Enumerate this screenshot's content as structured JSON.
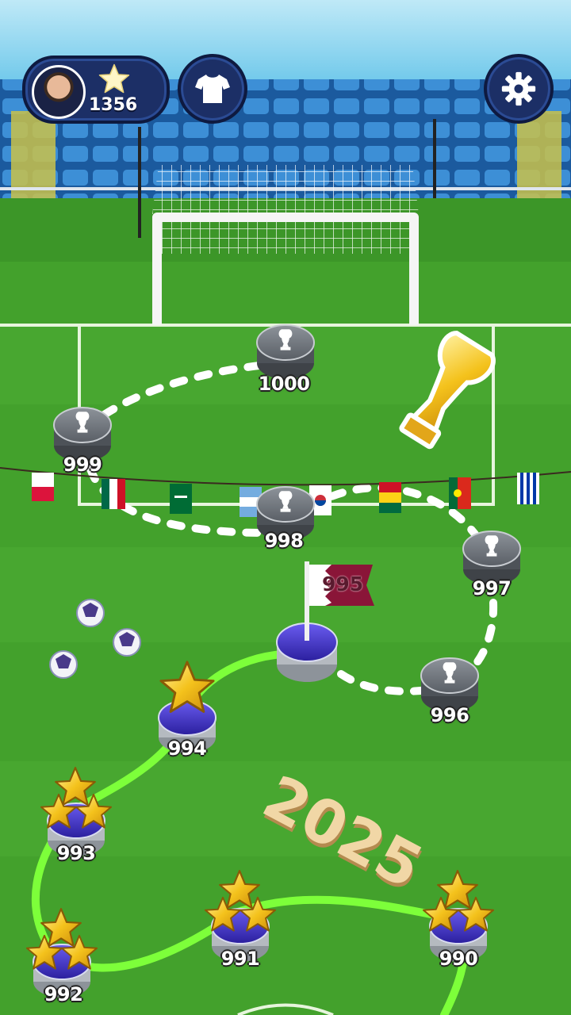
{
  "hud": {
    "stars_count": "1356",
    "icons": [
      "player-avatar",
      "star-icon",
      "shirt-icon",
      "gear-icon"
    ]
  },
  "map": {
    "year_label": "2025",
    "current_level_flag": "995",
    "levels": [
      {
        "number": "990",
        "stars": 3,
        "state": "completed"
      },
      {
        "number": "991",
        "stars": 3,
        "state": "completed"
      },
      {
        "number": "992",
        "stars": 3,
        "state": "completed"
      },
      {
        "number": "993",
        "stars": 3,
        "state": "completed"
      },
      {
        "number": "994",
        "stars": 1,
        "state": "completed"
      },
      {
        "number": "995",
        "state": "current"
      },
      {
        "number": "996",
        "state": "locked"
      },
      {
        "number": "997",
        "state": "locked"
      },
      {
        "number": "998",
        "state": "locked"
      },
      {
        "number": "999",
        "state": "locked"
      },
      {
        "number": "1000",
        "state": "locked"
      }
    ],
    "flags": [
      "Poland",
      "Mexico",
      "Saudi Arabia",
      "Argentina",
      "South Korea",
      "Ghana",
      "Portugal",
      "Uruguay"
    ]
  },
  "colors": {
    "pitch_green": "#3f9a2a",
    "path_green": "#7dff3a",
    "hud_navy": "#1c2f66",
    "locked_gray": "#6b7077",
    "current_blue": "#3b2fbf",
    "year_gold": "#f1d7a6"
  }
}
